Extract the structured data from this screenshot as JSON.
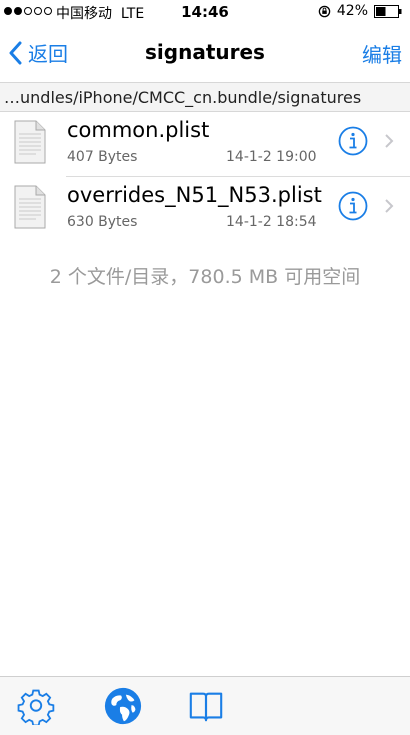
{
  "status_bar": {
    "carrier": "中国移动",
    "network": "LTE",
    "time": "14:46",
    "battery_percent": "42%",
    "signal_strength": 2,
    "icons": [
      "rotation-lock-icon",
      "battery-icon"
    ]
  },
  "nav": {
    "back_label": "返回",
    "title": "signatures",
    "edit_label": "编辑"
  },
  "path": "…undles/iPhone/CMCC_cn.bundle/signatures",
  "files": [
    {
      "name": "common.plist",
      "size": "407 Bytes",
      "date": "14-1-2 19:00"
    },
    {
      "name": "overrides_N51_N53.plist",
      "size": "630 Bytes",
      "date": "14-1-2 18:54"
    }
  ],
  "summary": "2 个文件/目录，780.5 MB 可用空间",
  "tabs": [
    "settings-gear-icon",
    "globe-icon",
    "book-icon"
  ],
  "colors": {
    "accent": "#1a7ee6",
    "secondary_text": "#666666",
    "summary_text": "#9a9a9a"
  }
}
